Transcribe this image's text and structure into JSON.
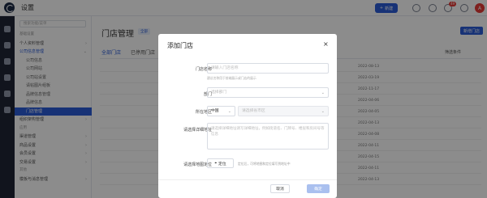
{
  "app": {
    "title": "设置",
    "new_button": "新建"
  },
  "notifications": {
    "count": "49"
  },
  "user": {
    "avatar_letter": "A"
  },
  "sidebar": {
    "search_placeholder": "搜索功能/菜单",
    "items": [
      {
        "label": "基础设置",
        "kind": "group"
      },
      {
        "label": "个人资料管理",
        "kind": "item"
      },
      {
        "label": "公司信息管理",
        "kind": "item-open"
      },
      {
        "label": "公司信息",
        "kind": "sub"
      },
      {
        "label": "公司网站",
        "kind": "sub"
      },
      {
        "label": "公司站设置",
        "kind": "sub"
      },
      {
        "label": "请帖图片组板",
        "kind": "sub"
      },
      {
        "label": "品牌信息管理",
        "kind": "sub"
      },
      {
        "label": "品牌信息",
        "kind": "sub"
      },
      {
        "label": "门店管理",
        "kind": "active"
      },
      {
        "label": "组织架构管理",
        "kind": "item"
      },
      {
        "label": "应用",
        "kind": "group"
      },
      {
        "label": "渠道管理",
        "kind": "item"
      },
      {
        "label": "商品设置",
        "kind": "item"
      },
      {
        "label": "会员设置",
        "kind": "item"
      },
      {
        "label": "交易设置",
        "kind": "item"
      },
      {
        "label": "其他",
        "kind": "group"
      },
      {
        "label": "模板与消息管理",
        "kind": "item"
      }
    ]
  },
  "main": {
    "title": "门店管理",
    "tag": "全部",
    "add_button": "新增门店",
    "tabs": [
      "全部门店",
      "已停用门店"
    ],
    "filter_label": "筛选条件",
    "rows": [
      {
        "date": "2022-08-13",
        "name": "",
        "tag_blue": "",
        "tag_red": ""
      },
      {
        "date": "2022-03-19",
        "name": "",
        "tag_blue": "",
        "tag_red": ""
      },
      {
        "date": "2022-11-17",
        "name": "",
        "tag_blue": "",
        "tag_red": ""
      },
      {
        "date": "2022-04-06",
        "name": "",
        "tag_blue": "",
        "tag_red": ""
      },
      {
        "date": "2022-04-05",
        "name": "",
        "tag_blue": "",
        "tag_red": ""
      },
      {
        "date": "2022-04-13",
        "name": "",
        "tag_blue": "",
        "tag_red": ""
      },
      {
        "date": "2022-04-08",
        "name": "",
        "tag_blue": "",
        "tag_red": ""
      },
      {
        "date": "2022-04-11",
        "name": "",
        "tag_blue": "",
        "tag_red": ""
      },
      {
        "date": "2022-04-15",
        "name": "",
        "tag_blue": "",
        "tag_red": ""
      },
      {
        "date": "2022-04-11",
        "name": "",
        "tag_blue": "",
        "tag_red": ""
      },
      {
        "date": "2022-04-13",
        "name": "",
        "tag_blue": "",
        "tag_red": ""
      }
    ]
  },
  "modal": {
    "title": "添加门店",
    "fields": {
      "name_label": "门店名称",
      "name_placeholder": "请输入门店名称",
      "name_hint": "建议名称用于前端展示或门店的展示",
      "dept_label": "部门",
      "dept_placeholder": "选择部门",
      "region_label": "所在地区",
      "country_value": "中国",
      "province_placeholder": "请选择省市区",
      "address_label": "请选择详细地址",
      "address_placeholder": "请选择详细地址请写详细地址，例如街道名、门牌号、楼层和房间号等信息",
      "map_label": "请选择地图定位",
      "locate_button": "定位",
      "locate_hint": "定位后，可将地图和定位填写到地址中"
    },
    "cancel_button": "取消",
    "ok_button": "确定"
  }
}
